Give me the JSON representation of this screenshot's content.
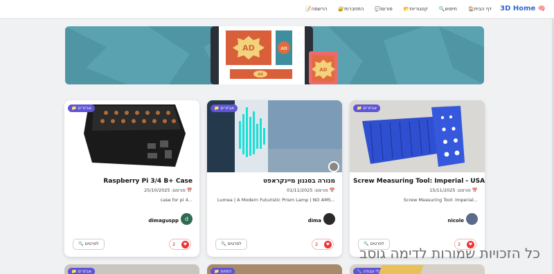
{
  "nav": {
    "brand": "3D Home",
    "brand_icon": "🧠",
    "links": [
      {
        "icon": "🏠",
        "label": "דף הבית"
      },
      {
        "icon": "🔍",
        "label": "חיפוש"
      },
      {
        "icon": "📂",
        "label": "קטגוריות"
      },
      {
        "icon": "💬",
        "label": "פורום"
      },
      {
        "icon": "🔐",
        "label": "התחברות"
      },
      {
        "icon": "📝",
        "label": "הרשמה"
      }
    ]
  },
  "banner": {
    "ad_big": "AD",
    "ad_small": "AD",
    "ad_bar": "AD",
    "ad_tablet": "AD"
  },
  "cards": [
    {
      "category": "📁 אביזרים",
      "title": "Screw Measuring Tool: Imperial - USA",
      "date": "📅 פורסם: 15/11/2025",
      "desc": "Screw Measuring Tool: Imperial...",
      "author": "nicole",
      "avatar_letter": "",
      "likes": "2",
      "details_label": "🔍 לפרטים",
      "colors": {
        "badge": "#5e54d6"
      }
    },
    {
      "category": "📁 אביזרים",
      "title": "מנורה בסגנון מיינקראפט",
      "date": "📅 פורסם: 01/11/2025",
      "desc": "Lumea | A Modern Futuristic Prism Lamp | NO AMS...",
      "author": "dima",
      "avatar_letter": "",
      "likes": "2",
      "details_label": "🔍 לפרטים",
      "colors": {
        "badge": "#5e54d6"
      }
    },
    {
      "category": "📁 אביזרים",
      "title": "Raspberry Pi 3/4 B+ Case",
      "date": "📅 פורסם: 25/10/2025",
      "desc": "case for pi 4...",
      "author": "dimaguspp",
      "avatar_letter": "d",
      "likes": "2",
      "details_label": "🔍 לפרטים",
      "colors": {
        "badge": "#5e54d6"
      }
    }
  ],
  "row2": [
    {
      "category": "🔧 כלי עבודה"
    },
    {
      "category": "📁 דמויות"
    },
    {
      "category": "📁 אביזרים"
    }
  ],
  "watermark": "כל הזכויות שמורות לדימה גוסב"
}
